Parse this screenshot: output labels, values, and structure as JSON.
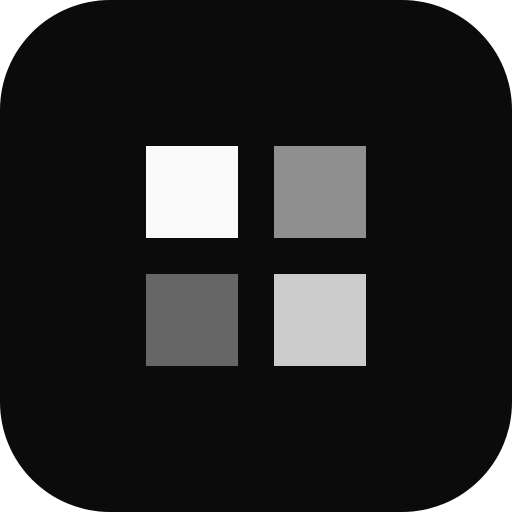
{
  "icon": {
    "name": "grid-app-icon",
    "background_color": "#0b0b0b",
    "tiles": [
      {
        "name": "top-left-tile",
        "color": "#fafafa"
      },
      {
        "name": "top-right-tile",
        "color": "#8f8f8f"
      },
      {
        "name": "bottom-left-tile",
        "color": "#666666"
      },
      {
        "name": "bottom-right-tile",
        "color": "#cccccc"
      }
    ]
  }
}
